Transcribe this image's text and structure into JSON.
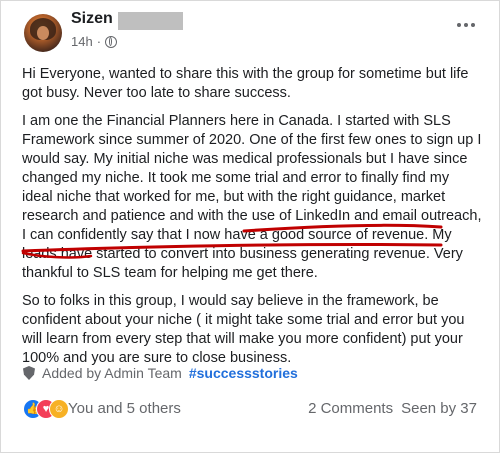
{
  "post": {
    "author": "Sizen",
    "time": "14h",
    "paragraphs": {
      "p1": "Hi Everyone, wanted to share this with the group for sometime but life got busy. Never too late to share success.",
      "p2_before": "I am one the Financial Planners here in Canada. I started with SLS Framework since summer of 2020. One of the first few ones to sign up I would say. My initial niche was medical professionals but I have since changed my niche. It took me some trial and error to finally find my ideal niche that worked for me, but with the right guidance, market research and patience and with the use of LinkedIn and email outreach, I can confidently say that ",
      "p2_highlight": "I now have a good source of revenue. My leads have started to convert into business generating revenue.",
      "p2_after": " Very thankful to SLS team for helping me get there.",
      "p3": "So to folks in this group, I would say believe in the framework, be confident about your niche ( it might take some trial and error but you will learn from every step that will make you more confident) put your 100% and you are sure to close business."
    },
    "added_by": "Added by Admin Team",
    "hashtag": "#successstories"
  },
  "footer": {
    "reactions_text": "You and 5 others",
    "comments": "2 Comments",
    "seen": "Seen by 37"
  },
  "colors": {
    "hashtag": "#216fdb",
    "annotation": "#c00000",
    "like": "#1877f2",
    "love": "#f33e58",
    "care": "#f7b125"
  },
  "icons": [
    "globe-icon",
    "more-options-icon",
    "shield-icon",
    "like-reaction-icon",
    "love-reaction-icon",
    "care-reaction-icon"
  ]
}
